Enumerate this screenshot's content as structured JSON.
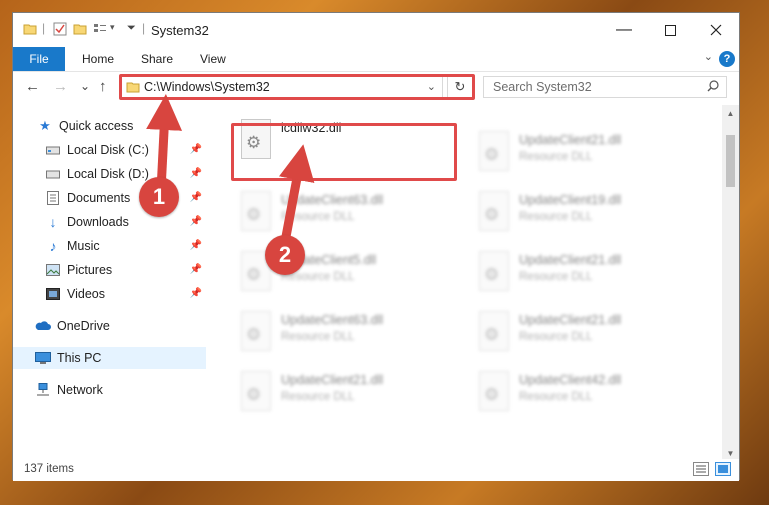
{
  "window": {
    "title": "System32"
  },
  "ribbon": {
    "file": "File",
    "tabs": [
      "Home",
      "Share",
      "View"
    ],
    "help": "?"
  },
  "nav": {
    "back": "←",
    "forward": "→",
    "recent": "⌄",
    "up": "↑"
  },
  "address": {
    "path": "C:\\Windows\\System32"
  },
  "search": {
    "placeholder": "Search System32"
  },
  "sidebar": {
    "quick_access": "Quick access",
    "items": [
      {
        "label": "Local Disk (C:)",
        "icon": "drive-icon"
      },
      {
        "label": "Local Disk (D:)",
        "icon": "drive-icon"
      },
      {
        "label": "Documents",
        "icon": "documents-icon"
      },
      {
        "label": "Downloads",
        "icon": "downloads-icon"
      },
      {
        "label": "Music",
        "icon": "music-icon"
      },
      {
        "label": "Pictures",
        "icon": "pictures-icon"
      },
      {
        "label": "Videos",
        "icon": "videos-icon"
      }
    ],
    "onedrive": "OneDrive",
    "thispc": "This PC",
    "network": "Network"
  },
  "files": [
    {
      "name": "icdllw32.dll",
      "type": ""
    },
    {
      "name": "UpdateClient21.dll",
      "type": "Resource DLL"
    },
    {
      "name": "UpdateClient63.dll",
      "type": "Resource DLL"
    },
    {
      "name": "UpdateClient19.dll",
      "type": "Resource DLL"
    },
    {
      "name": "UpdateClient5.dll",
      "type": "Resource DLL"
    },
    {
      "name": "UpdateClient21.dll",
      "type": "Resource DLL"
    },
    {
      "name": "UpdateClient63.dll",
      "type": "Resource DLL"
    },
    {
      "name": "UpdateClient21.dll",
      "type": "Resource DLL"
    },
    {
      "name": "UpdateClient21.dll",
      "type": "Resource DLL"
    },
    {
      "name": "UpdateClient42.dll",
      "type": "Resource DLL"
    }
  ],
  "status": {
    "count": "137 items"
  },
  "annotations": {
    "step1": "1",
    "step2": "2",
    "color": "#d8453f"
  }
}
